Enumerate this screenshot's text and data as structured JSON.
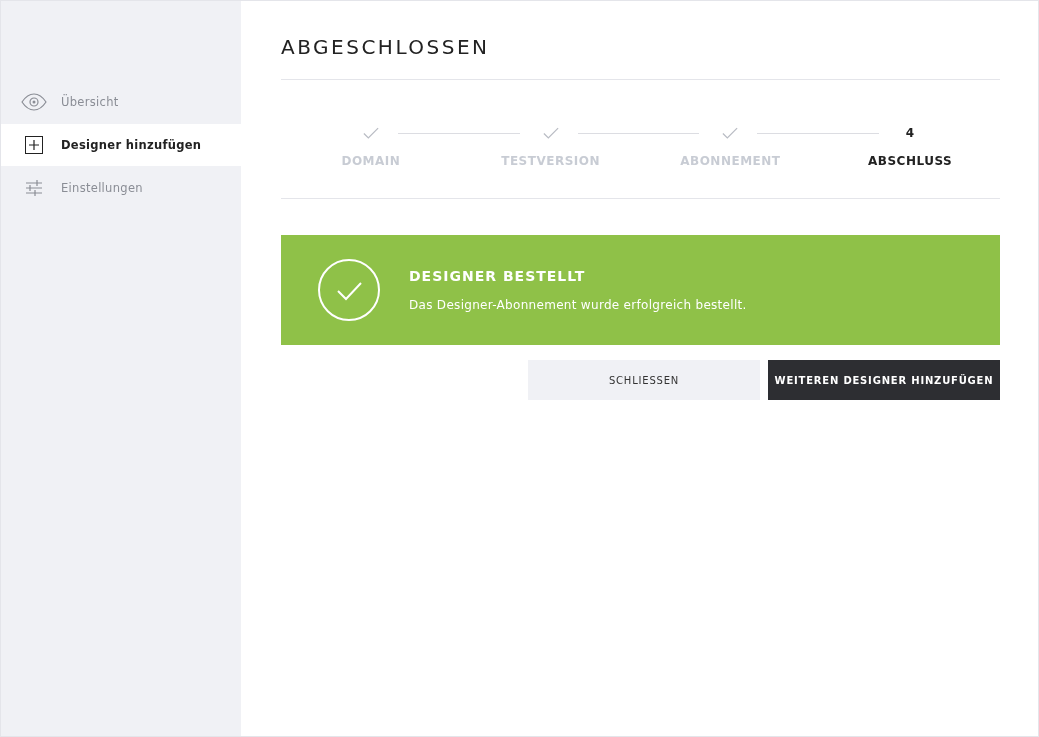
{
  "sidebar": {
    "items": [
      {
        "label": "Übersicht",
        "kind": "overview",
        "selected": false
      },
      {
        "label": "Designer hinzufügen",
        "kind": "add",
        "selected": true
      },
      {
        "label": "Einstellungen",
        "kind": "settings",
        "selected": false
      }
    ]
  },
  "title": "ABGESCHLOSSEN",
  "steps": [
    {
      "label": "DOMAIN",
      "completed": true,
      "selected": false
    },
    {
      "label": "TESTVERSION",
      "completed": true,
      "selected": false
    },
    {
      "label": "ABONNEMENT",
      "completed": true,
      "selected": false
    },
    {
      "label": "ABSCHLUSS",
      "completed": false,
      "selected": true,
      "marker": "4"
    }
  ],
  "alert": {
    "title": "DESIGNER BESTELLT",
    "message": "Das Designer-Abonnement wurde erfolgreich bestellt."
  },
  "buttons": [
    {
      "label": "SCHLIESSEN",
      "kind": "secondary"
    },
    {
      "label": "WEITEREN DESIGNER HINZUFÜGEN",
      "kind": "primary"
    }
  ]
}
